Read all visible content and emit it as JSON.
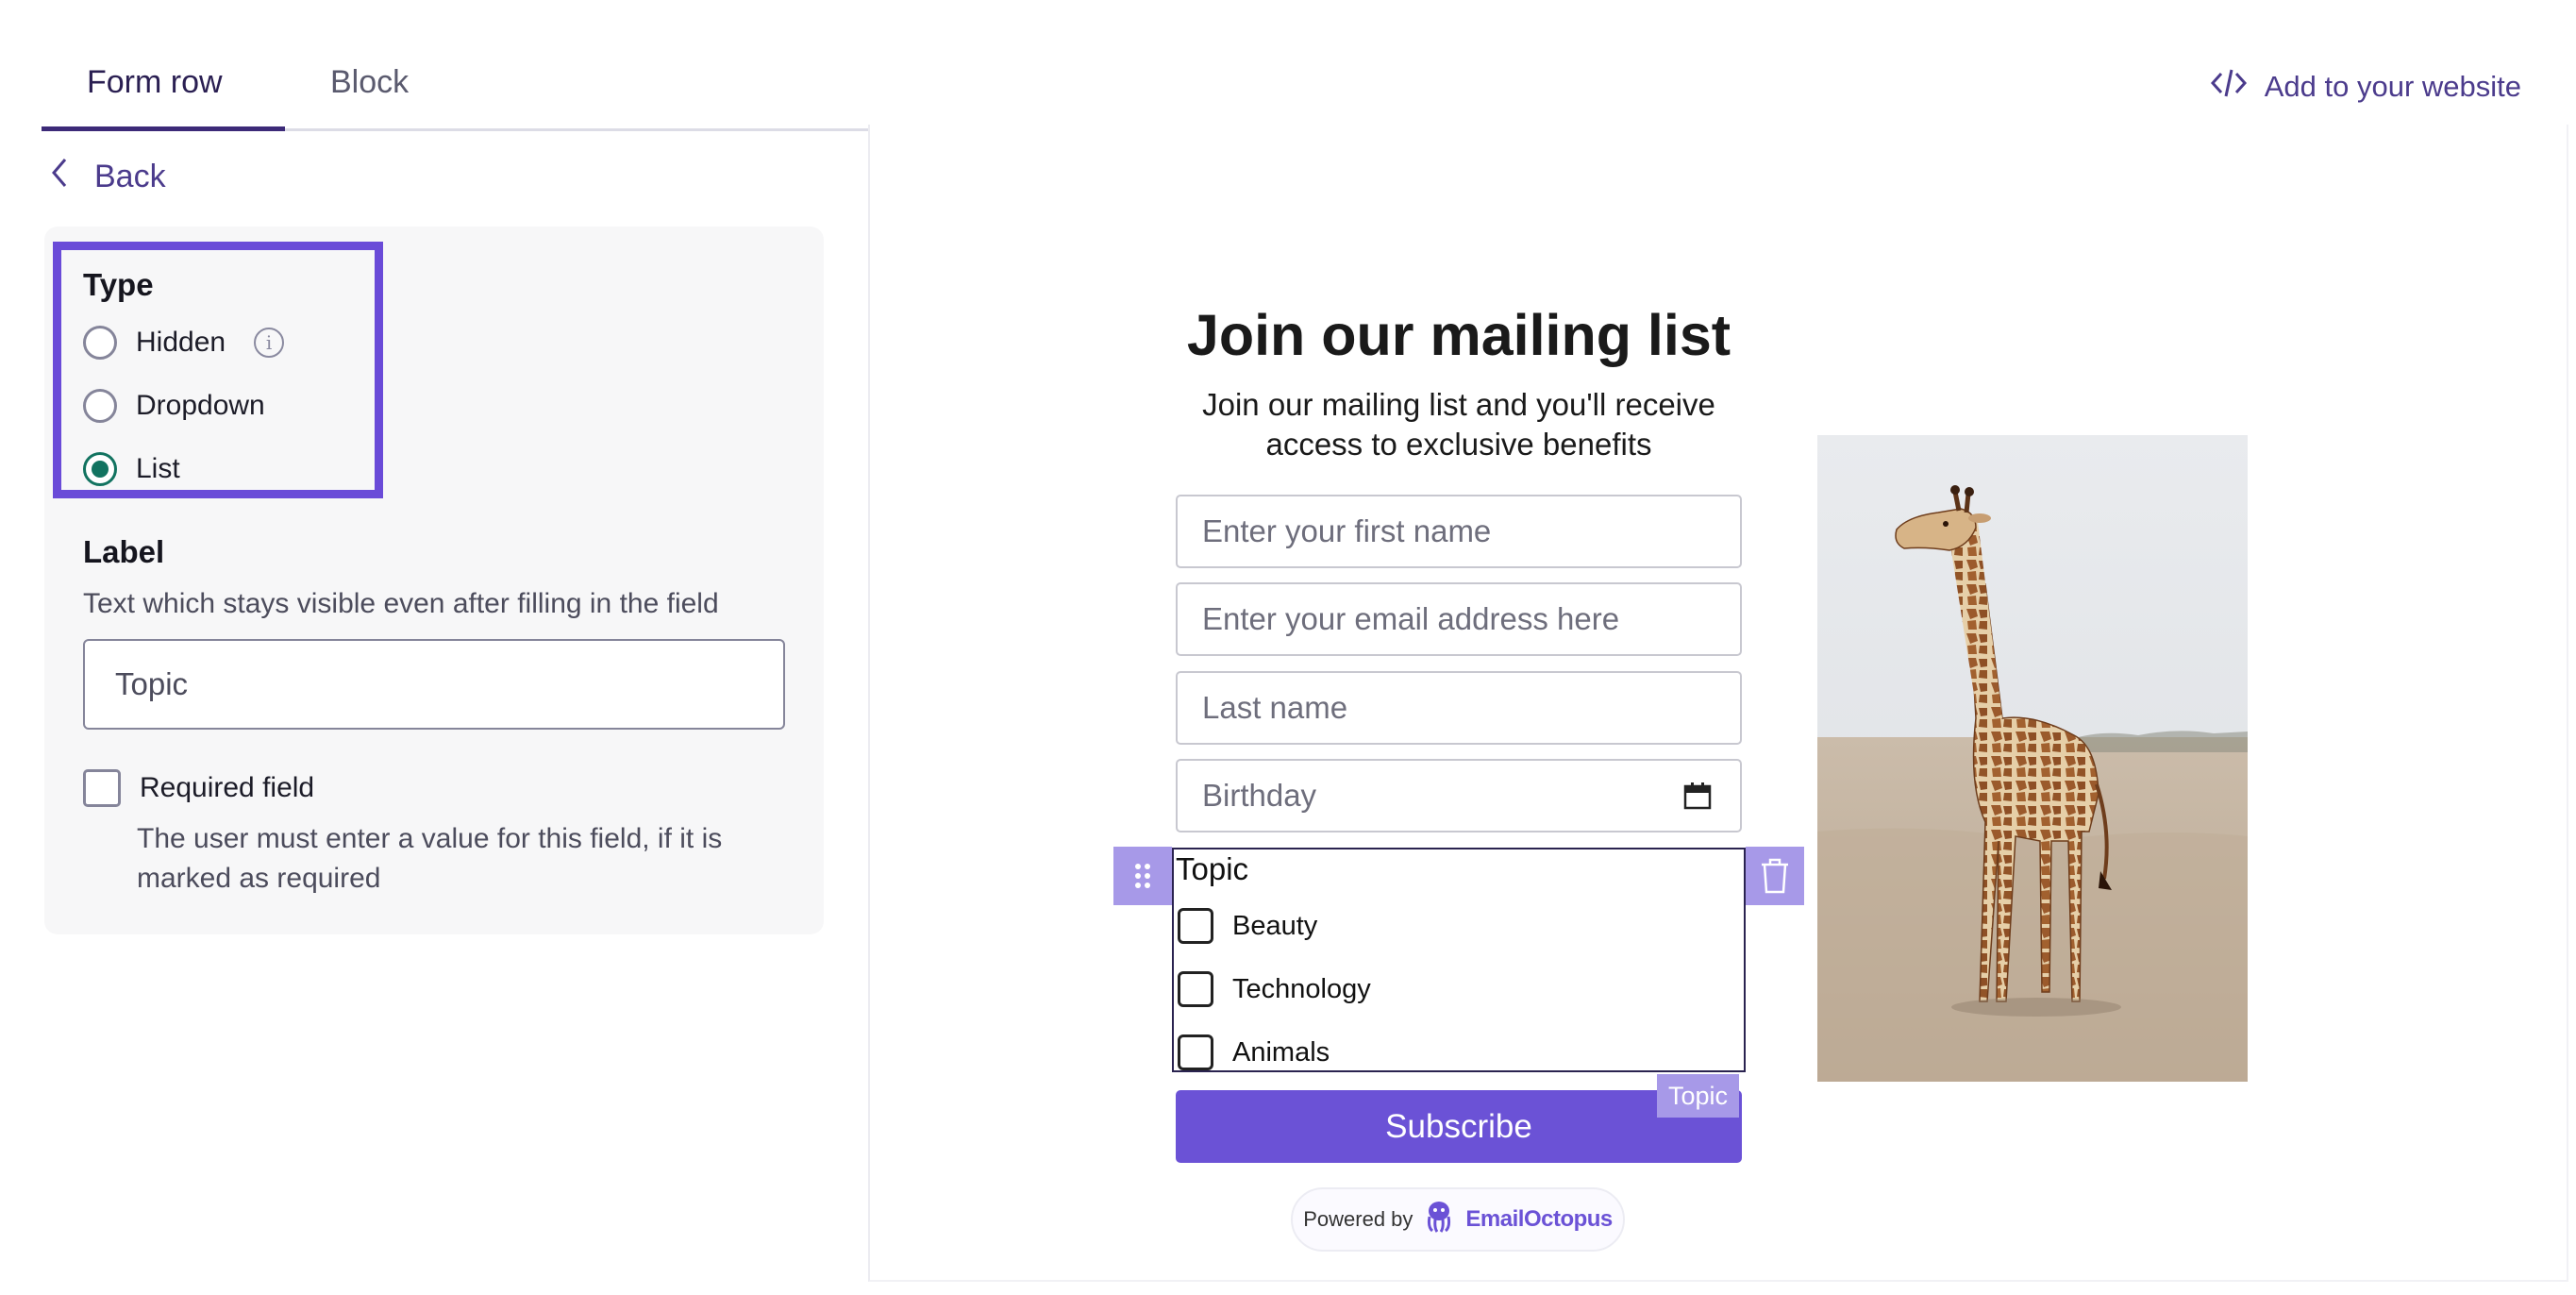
{
  "tabs": [
    {
      "label": "Form row",
      "active": true
    },
    {
      "label": "Block",
      "active": false
    }
  ],
  "header": {
    "add_to_website": "Add to your website",
    "add_icon": "code-icon"
  },
  "panel": {
    "back_label": "Back",
    "type": {
      "title": "Type",
      "options": [
        {
          "label": "Hidden",
          "checked": false,
          "has_info": true
        },
        {
          "label": "Dropdown",
          "checked": false
        },
        {
          "label": "List",
          "checked": true
        }
      ]
    },
    "label_section": {
      "title": "Label",
      "helper": "Text which stays visible even after filling in the field",
      "value": "Topic"
    },
    "required": {
      "label": "Required field",
      "checked": false,
      "helper": "The user must enter a value for this field, if it is marked as required"
    }
  },
  "form": {
    "title": "Join our mailing list",
    "subtitle": "Join our mailing list and you'll receive access to exclusive benefits",
    "fields": [
      {
        "placeholder": "Enter your first name"
      },
      {
        "placeholder": "Enter your email address here"
      },
      {
        "placeholder": "Last name"
      },
      {
        "placeholder": "Birthday",
        "icon": "calendar-icon"
      }
    ],
    "topic": {
      "label": "Topic",
      "options": [
        "Beauty",
        "Technology",
        "Animals"
      ],
      "tag": "Topic"
    },
    "subscribe_label": "Subscribe",
    "powered_by": "Powered by",
    "brand": "EmailOctopus",
    "image": "giraffe-photo"
  },
  "colors": {
    "accent": "#6b52d6",
    "highlight": "#6a4bd8",
    "radio_checked": "#127360",
    "link": "#4b3b8c"
  }
}
